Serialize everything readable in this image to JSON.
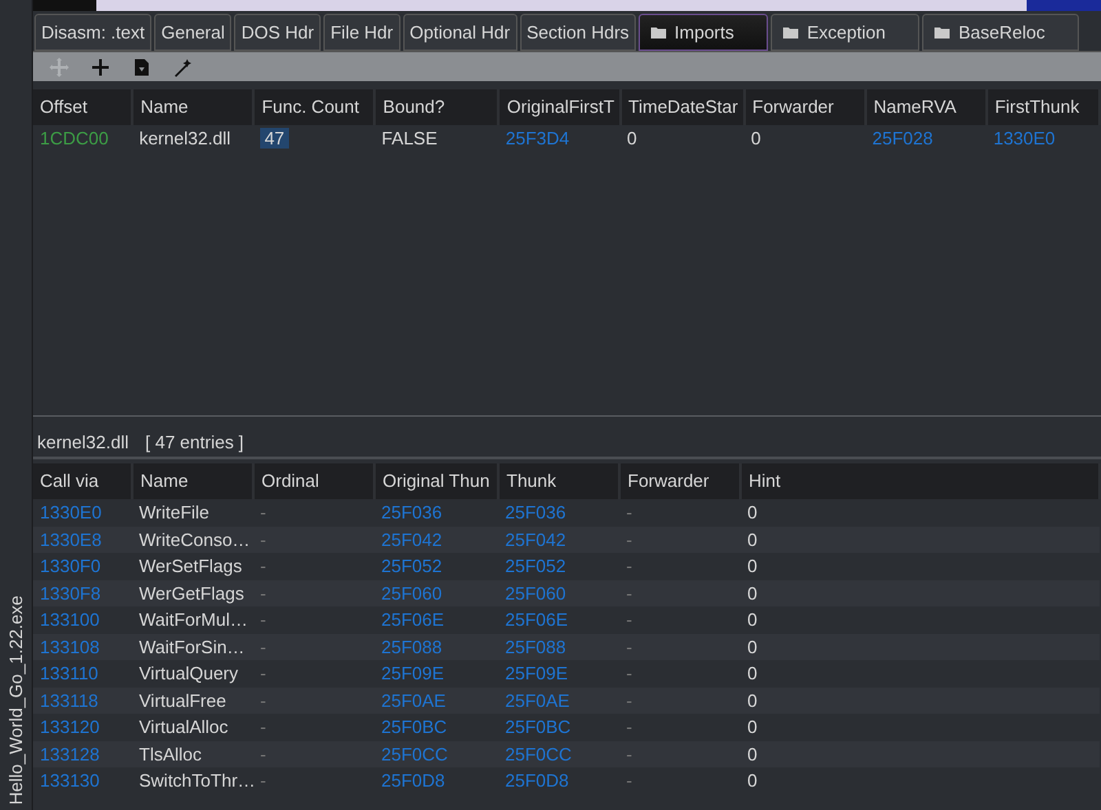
{
  "sidebar": {
    "title": "Hello_World_Go_1.22.exe"
  },
  "tabs": [
    {
      "label": "Disasm: .text",
      "kind": "plain",
      "selected": false
    },
    {
      "label": "General",
      "kind": "plain",
      "selected": false
    },
    {
      "label": "DOS Hdr",
      "kind": "plain",
      "selected": false
    },
    {
      "label": "File Hdr",
      "kind": "plain",
      "selected": false
    },
    {
      "label": "Optional Hdr",
      "kind": "plain",
      "selected": false
    },
    {
      "label": "Section Hdrs",
      "kind": "plain",
      "selected": false
    },
    {
      "label": "Imports",
      "kind": "folder",
      "selected": true
    },
    {
      "label": "Exception",
      "kind": "folder",
      "selected": false
    },
    {
      "label": "BaseReloc",
      "kind": "folder",
      "selected": false
    }
  ],
  "toolbar": [
    {
      "kind": "move",
      "disabled": true
    },
    {
      "kind": "add",
      "disabled": false
    },
    {
      "kind": "save",
      "disabled": false
    },
    {
      "kind": "wand",
      "disabled": false
    }
  ],
  "imports_table": {
    "columns": [
      {
        "label": "Offset",
        "kind": "offset"
      },
      {
        "label": "Name",
        "kind": "text"
      },
      {
        "label": "Func. Count",
        "kind": "text"
      },
      {
        "label": "Bound?",
        "kind": "text"
      },
      {
        "label": "OriginalFirstT",
        "kind": "address"
      },
      {
        "label": "TimeDateStar",
        "kind": "text"
      },
      {
        "label": "Forwarder",
        "kind": "text"
      },
      {
        "label": "NameRVA",
        "kind": "address"
      },
      {
        "label": "FirstThunk",
        "kind": "address"
      }
    ],
    "rows": [
      {
        "cells": [
          {
            "text": "1CDC00",
            "selected": false
          },
          {
            "text": "kernel32.dll",
            "selected": false
          },
          {
            "text": "47",
            "selected": true
          },
          {
            "text": "FALSE",
            "selected": false
          },
          {
            "text": "25F3D4",
            "selected": false
          },
          {
            "text": "0",
            "selected": false
          },
          {
            "text": "0",
            "selected": false
          },
          {
            "text": "25F028",
            "selected": false
          },
          {
            "text": "1330E0",
            "selected": false
          }
        ]
      }
    ]
  },
  "functions_label": {
    "dll": "kernel32.dll",
    "count": "[ 47 entries ]"
  },
  "functions_table": {
    "columns": [
      {
        "label": "Call via",
        "kind": "address"
      },
      {
        "label": "Name",
        "kind": "text"
      },
      {
        "label": "Ordinal",
        "kind": "dim"
      },
      {
        "label": "Original Thun",
        "kind": "address"
      },
      {
        "label": "Thunk",
        "kind": "address"
      },
      {
        "label": "Forwarder",
        "kind": "dim"
      },
      {
        "label": "Hint",
        "kind": "text"
      }
    ],
    "rows": [
      [
        "1330E0",
        "WriteFile",
        "-",
        "25F036",
        "25F036",
        "-",
        "0"
      ],
      [
        "1330E8",
        "WriteConso…",
        "-",
        "25F042",
        "25F042",
        "-",
        "0"
      ],
      [
        "1330F0",
        "WerSetFlags",
        "-",
        "25F052",
        "25F052",
        "-",
        "0"
      ],
      [
        "1330F8",
        "WerGetFlags",
        "-",
        "25F060",
        "25F060",
        "-",
        "0"
      ],
      [
        "133100",
        "WaitForMul…",
        "-",
        "25F06E",
        "25F06E",
        "-",
        "0"
      ],
      [
        "133108",
        "WaitForSin…",
        "-",
        "25F088",
        "25F088",
        "-",
        "0"
      ],
      [
        "133110",
        "VirtualQuery",
        "-",
        "25F09E",
        "25F09E",
        "-",
        "0"
      ],
      [
        "133118",
        "VirtualFree",
        "-",
        "25F0AE",
        "25F0AE",
        "-",
        "0"
      ],
      [
        "133120",
        "VirtualAlloc",
        "-",
        "25F0BC",
        "25F0BC",
        "-",
        "0"
      ],
      [
        "133128",
        "TlsAlloc",
        "-",
        "25F0CC",
        "25F0CC",
        "-",
        "0"
      ],
      [
        "133130",
        "SwitchToThr…",
        "-",
        "25F0D8",
        "25F0D8",
        "-",
        "0"
      ]
    ]
  }
}
